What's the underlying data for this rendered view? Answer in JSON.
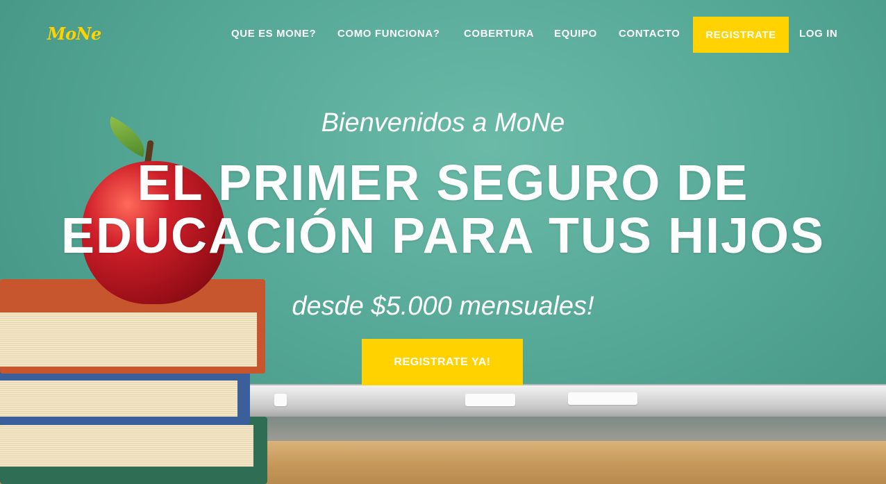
{
  "brand": {
    "logo_text": "MoNe",
    "accent_color": "#ffd200"
  },
  "nav": {
    "items": [
      {
        "label": "QUE ES MONE?"
      },
      {
        "label": "COMO FUNCIONA?"
      },
      {
        "label": "COBERTURA"
      },
      {
        "label": "EQUIPO"
      },
      {
        "label": "CONTACTO"
      }
    ],
    "cta_label": "REGISTRATE",
    "login_label": "LOG IN"
  },
  "hero": {
    "welcome": "Bienvenidos a MoNe",
    "headline_line1": "EL PRIMER SEGURO DE",
    "headline_line2": "EDUCACIÓN PARA TUS HIJOS",
    "price_text": "desde $5.000 mensuales!",
    "cta_label": "REGISTRATE YA!"
  }
}
